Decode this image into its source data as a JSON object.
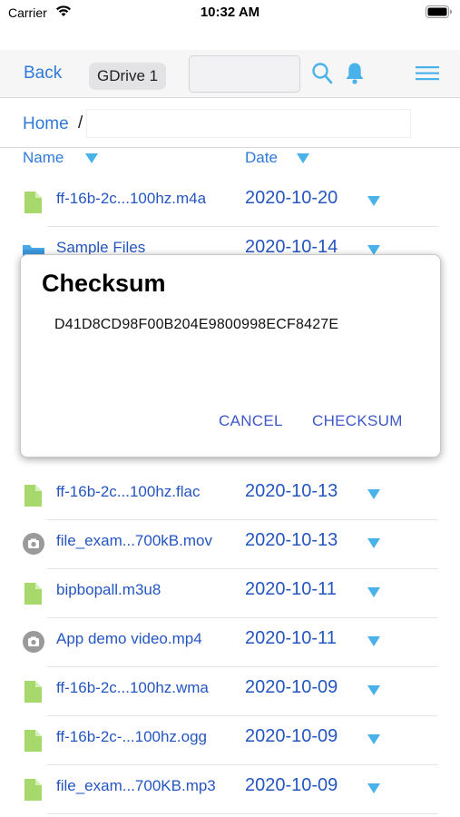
{
  "status_bar": {
    "carrier": "Carrier",
    "time": "10:32 AM",
    "icons": [
      "wifi-icon",
      "battery-icon"
    ]
  },
  "nav": {
    "back_label": "Back",
    "drive_label": "GDrive 1",
    "search_value": "",
    "icons": [
      "search-icon",
      "bell-icon",
      "menu-icon"
    ],
    "accent_color": "#2f7ad8"
  },
  "breadcrumb": {
    "home_label": "Home",
    "separator": "/",
    "path_value": ""
  },
  "columns": {
    "name_label": "Name",
    "date_label": "Date"
  },
  "files": [
    {
      "icon": "file-icon",
      "name": "ff-16b-2c...100hz.m4a",
      "date": "2020-10-20"
    },
    {
      "icon": "folder-icon",
      "name": "Sample Files",
      "date": "2020-10-14"
    },
    {
      "icon": "file-icon",
      "name": "ff-16b-2c...100hz.flac",
      "date": "2020-10-13"
    },
    {
      "icon": "video-icon",
      "name": "file_exam...700kB.mov",
      "date": "2020-10-13"
    },
    {
      "icon": "file-icon",
      "name": "bipbopall.m3u8",
      "date": "2020-10-11"
    },
    {
      "icon": "video-icon",
      "name": "App demo video.mp4",
      "date": "2020-10-11"
    },
    {
      "icon": "file-icon",
      "name": "ff-16b-2c...100hz.wma",
      "date": "2020-10-09"
    },
    {
      "icon": "file-icon",
      "name": "ff-16b-2c-...100hz.ogg",
      "date": "2020-10-09"
    },
    {
      "icon": "file-icon",
      "name": "file_exam...700KB.mp3",
      "date": "2020-10-09"
    }
  ],
  "dialog": {
    "title": "Checksum",
    "checksum": "D41D8CD98F00B204E9800998ECF8427E",
    "cancel_label": "CANCEL",
    "confirm_label": "CHECKSUM"
  },
  "colors": {
    "link_blue": "#2f7ad8",
    "item_text_blue": "#2556bf",
    "triangle_blue": "#4ab2ea",
    "file_green": "#a6d86b",
    "folder_blue": "#4aa8e8",
    "dialog_button": "#3f58c6"
  }
}
